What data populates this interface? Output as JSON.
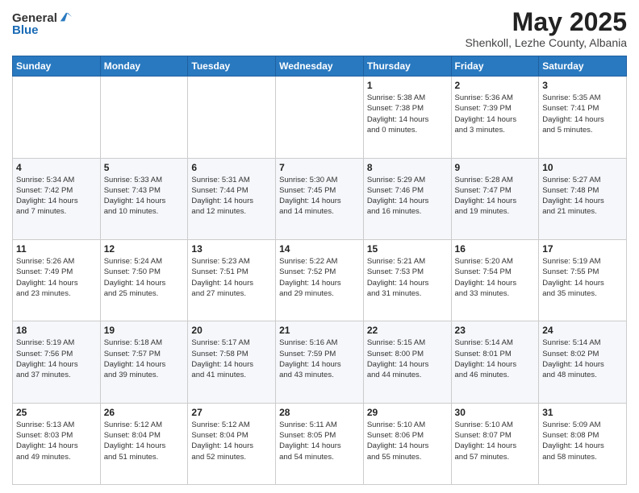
{
  "logo": {
    "general": "General",
    "blue": "Blue"
  },
  "header": {
    "month": "May 2025",
    "location": "Shenkoll, Lezhe County, Albania"
  },
  "days_of_week": [
    "Sunday",
    "Monday",
    "Tuesday",
    "Wednesday",
    "Thursday",
    "Friday",
    "Saturday"
  ],
  "weeks": [
    [
      {
        "day": "",
        "info": ""
      },
      {
        "day": "",
        "info": ""
      },
      {
        "day": "",
        "info": ""
      },
      {
        "day": "",
        "info": ""
      },
      {
        "day": "1",
        "info": "Sunrise: 5:38 AM\nSunset: 7:38 PM\nDaylight: 14 hours\nand 0 minutes."
      },
      {
        "day": "2",
        "info": "Sunrise: 5:36 AM\nSunset: 7:39 PM\nDaylight: 14 hours\nand 3 minutes."
      },
      {
        "day": "3",
        "info": "Sunrise: 5:35 AM\nSunset: 7:41 PM\nDaylight: 14 hours\nand 5 minutes."
      }
    ],
    [
      {
        "day": "4",
        "info": "Sunrise: 5:34 AM\nSunset: 7:42 PM\nDaylight: 14 hours\nand 7 minutes."
      },
      {
        "day": "5",
        "info": "Sunrise: 5:33 AM\nSunset: 7:43 PM\nDaylight: 14 hours\nand 10 minutes."
      },
      {
        "day": "6",
        "info": "Sunrise: 5:31 AM\nSunset: 7:44 PM\nDaylight: 14 hours\nand 12 minutes."
      },
      {
        "day": "7",
        "info": "Sunrise: 5:30 AM\nSunset: 7:45 PM\nDaylight: 14 hours\nand 14 minutes."
      },
      {
        "day": "8",
        "info": "Sunrise: 5:29 AM\nSunset: 7:46 PM\nDaylight: 14 hours\nand 16 minutes."
      },
      {
        "day": "9",
        "info": "Sunrise: 5:28 AM\nSunset: 7:47 PM\nDaylight: 14 hours\nand 19 minutes."
      },
      {
        "day": "10",
        "info": "Sunrise: 5:27 AM\nSunset: 7:48 PM\nDaylight: 14 hours\nand 21 minutes."
      }
    ],
    [
      {
        "day": "11",
        "info": "Sunrise: 5:26 AM\nSunset: 7:49 PM\nDaylight: 14 hours\nand 23 minutes."
      },
      {
        "day": "12",
        "info": "Sunrise: 5:24 AM\nSunset: 7:50 PM\nDaylight: 14 hours\nand 25 minutes."
      },
      {
        "day": "13",
        "info": "Sunrise: 5:23 AM\nSunset: 7:51 PM\nDaylight: 14 hours\nand 27 minutes."
      },
      {
        "day": "14",
        "info": "Sunrise: 5:22 AM\nSunset: 7:52 PM\nDaylight: 14 hours\nand 29 minutes."
      },
      {
        "day": "15",
        "info": "Sunrise: 5:21 AM\nSunset: 7:53 PM\nDaylight: 14 hours\nand 31 minutes."
      },
      {
        "day": "16",
        "info": "Sunrise: 5:20 AM\nSunset: 7:54 PM\nDaylight: 14 hours\nand 33 minutes."
      },
      {
        "day": "17",
        "info": "Sunrise: 5:19 AM\nSunset: 7:55 PM\nDaylight: 14 hours\nand 35 minutes."
      }
    ],
    [
      {
        "day": "18",
        "info": "Sunrise: 5:19 AM\nSunset: 7:56 PM\nDaylight: 14 hours\nand 37 minutes."
      },
      {
        "day": "19",
        "info": "Sunrise: 5:18 AM\nSunset: 7:57 PM\nDaylight: 14 hours\nand 39 minutes."
      },
      {
        "day": "20",
        "info": "Sunrise: 5:17 AM\nSunset: 7:58 PM\nDaylight: 14 hours\nand 41 minutes."
      },
      {
        "day": "21",
        "info": "Sunrise: 5:16 AM\nSunset: 7:59 PM\nDaylight: 14 hours\nand 43 minutes."
      },
      {
        "day": "22",
        "info": "Sunrise: 5:15 AM\nSunset: 8:00 PM\nDaylight: 14 hours\nand 44 minutes."
      },
      {
        "day": "23",
        "info": "Sunrise: 5:14 AM\nSunset: 8:01 PM\nDaylight: 14 hours\nand 46 minutes."
      },
      {
        "day": "24",
        "info": "Sunrise: 5:14 AM\nSunset: 8:02 PM\nDaylight: 14 hours\nand 48 minutes."
      }
    ],
    [
      {
        "day": "25",
        "info": "Sunrise: 5:13 AM\nSunset: 8:03 PM\nDaylight: 14 hours\nand 49 minutes."
      },
      {
        "day": "26",
        "info": "Sunrise: 5:12 AM\nSunset: 8:04 PM\nDaylight: 14 hours\nand 51 minutes."
      },
      {
        "day": "27",
        "info": "Sunrise: 5:12 AM\nSunset: 8:04 PM\nDaylight: 14 hours\nand 52 minutes."
      },
      {
        "day": "28",
        "info": "Sunrise: 5:11 AM\nSunset: 8:05 PM\nDaylight: 14 hours\nand 54 minutes."
      },
      {
        "day": "29",
        "info": "Sunrise: 5:10 AM\nSunset: 8:06 PM\nDaylight: 14 hours\nand 55 minutes."
      },
      {
        "day": "30",
        "info": "Sunrise: 5:10 AM\nSunset: 8:07 PM\nDaylight: 14 hours\nand 57 minutes."
      },
      {
        "day": "31",
        "info": "Sunrise: 5:09 AM\nSunset: 8:08 PM\nDaylight: 14 hours\nand 58 minutes."
      }
    ]
  ]
}
